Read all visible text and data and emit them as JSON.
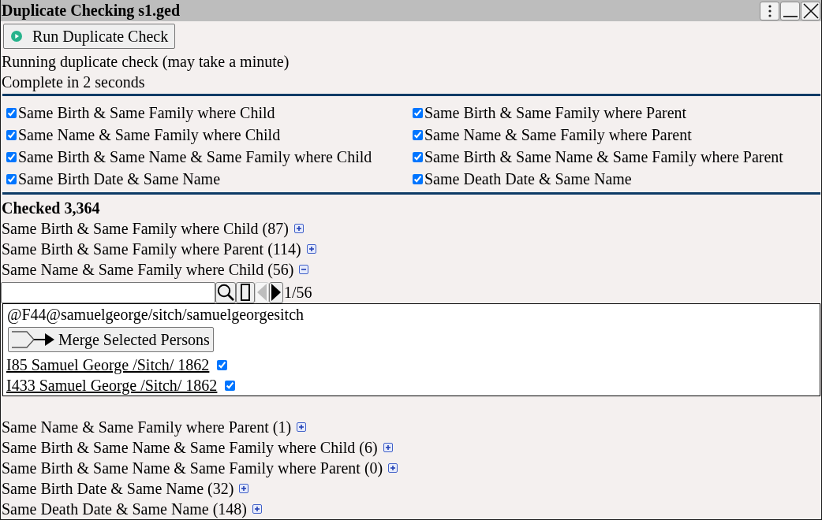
{
  "window": {
    "title": "Duplicate Checking s1.ged"
  },
  "run_button": {
    "label": "Run Duplicate Check"
  },
  "status_lines": [
    "Running duplicate check (may take a minute)",
    "Complete in 2 seconds"
  ],
  "criteria": [
    {
      "label": "Same Birth & Same Family where Child",
      "checked": true
    },
    {
      "label": "Same Birth & Same Family where Parent",
      "checked": true
    },
    {
      "label": "Same Name & Same Family where Child",
      "checked": true
    },
    {
      "label": "Same Name & Same Family where Parent",
      "checked": true
    },
    {
      "label": "Same Birth & Same Name & Same Family where Child",
      "checked": true
    },
    {
      "label": "Same Birth & Same Name & Same Family where Parent",
      "checked": true
    },
    {
      "label": "Same Birth Date & Same Name",
      "checked": true
    },
    {
      "label": "Same Death Date & Same Name",
      "checked": true
    }
  ],
  "checked_total": "Checked 3,364",
  "groups": [
    {
      "label": "Same Birth & Same Family where Child (87)",
      "expanded": false
    },
    {
      "label": "Same Birth & Same Family where Parent (114)",
      "expanded": false
    },
    {
      "label": "Same Name & Same Family where Child (56)",
      "expanded": true,
      "pager": {
        "position": "1/56",
        "prev": {
          "disabled": true
        },
        "next": {
          "disabled": false
        }
      },
      "matches": [
        {
          "family": "@F44@samuelgeorge/sitch/samuelgeorgesitch",
          "merge_button": "Merge Selected Persons",
          "persons": [
            {
              "label": "I85 Samuel George /Sitch/ 1862",
              "checked": true
            },
            {
              "label": "I433 Samuel George /Sitch/ 1862",
              "checked": true
            }
          ]
        }
      ]
    },
    {
      "label": "Same Name & Same Family where Parent (1)",
      "expanded": false
    },
    {
      "label": "Same Birth & Same Name & Same Family where Child (6)",
      "expanded": false
    },
    {
      "label": "Same Birth & Same Name & Same Family where Parent (0)",
      "expanded": false
    },
    {
      "label": "Same Birth Date & Same Name (32)",
      "expanded": false
    },
    {
      "label": "Same Death Date & Same Name (148)",
      "expanded": false
    }
  ]
}
